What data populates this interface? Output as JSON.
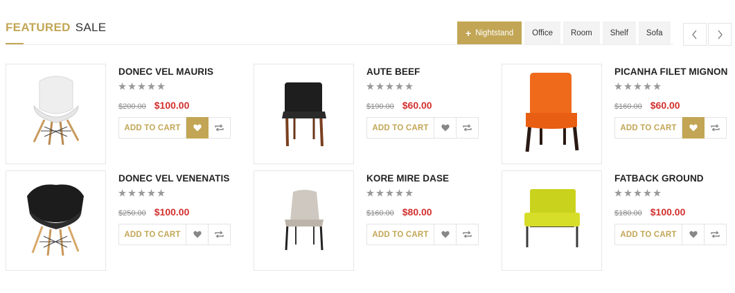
{
  "header": {
    "title_strong": "FEATURED",
    "title_light": "SALE"
  },
  "tabs": [
    {
      "label": "Nightstand",
      "active": true
    },
    {
      "label": "Office",
      "active": false
    },
    {
      "label": "Room",
      "active": false
    },
    {
      "label": "Shelf",
      "active": false
    },
    {
      "label": "Sofa",
      "active": false
    }
  ],
  "colors": {
    "accent": "#c2a655",
    "price": "#d32f2f",
    "star": "#9a9a9a"
  },
  "rating_max": 5,
  "products": [
    {
      "name": "DONEC VEL MAURIS",
      "old_price": "$200.00",
      "new_price": "$100.00",
      "rating": 0,
      "cart_label": "ADD TO CART",
      "wishlist_highlighted": true,
      "image": "white-eames-chair"
    },
    {
      "name": "AUTE BEEF",
      "old_price": "$190.00",
      "new_price": "$60.00",
      "rating": 0,
      "cart_label": "ADD TO CART",
      "wishlist_highlighted": false,
      "image": "black-dining-chair"
    },
    {
      "name": "PICANHA FILET MIGNON",
      "old_price": "$160.00",
      "new_price": "$60.00",
      "rating": 0,
      "cart_label": "ADD TO CART",
      "wishlist_highlighted": true,
      "image": "orange-upholstered-chair"
    },
    {
      "name": "DONEC VEL VENENATIS",
      "old_price": "$250.00",
      "new_price": "$100.00",
      "rating": 0,
      "cart_label": "ADD TO CART",
      "wishlist_highlighted": false,
      "image": "black-eames-armchair"
    },
    {
      "name": "KORE MIRE DASE",
      "old_price": "$160.00",
      "new_price": "$80.00",
      "rating": 0,
      "cart_label": "ADD TO CART",
      "wishlist_highlighted": false,
      "image": "grey-fabric-chair"
    },
    {
      "name": "FATBACK GROUND",
      "old_price": "$180.00",
      "new_price": "$100.00",
      "rating": 0,
      "cart_label": "ADD TO CART",
      "wishlist_highlighted": false,
      "image": "yellow-lounge-chair"
    }
  ]
}
